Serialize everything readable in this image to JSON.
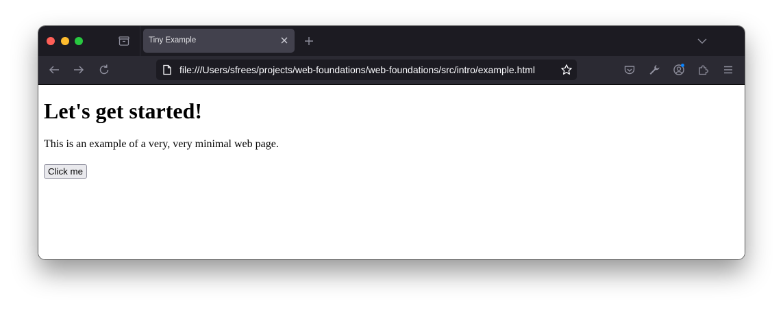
{
  "browser": {
    "window_controls": {
      "close_color": "#ff5f57",
      "minimize_color": "#febc2e",
      "maximize_color": "#28c840"
    },
    "tabs": [
      {
        "title": "Tiny Example",
        "active": true
      }
    ],
    "url": "file:///Users/sfrees/projects/web-foundations/web-foundations/src/intro/example.html",
    "toolbar_icons": [
      "back-arrow-icon",
      "forward-arrow-icon",
      "reload-icon",
      "page-icon",
      "bookmark-star-icon",
      "pocket-icon",
      "wrench-icon",
      "account-icon",
      "extensions-icon",
      "hamburger-menu-icon"
    ],
    "tab_icons": [
      "tab-manager-icon",
      "close-icon",
      "plus-icon",
      "chevron-down-icon"
    ],
    "colors": {
      "tabbar_bg": "#1c1b22",
      "toolbar_bg": "#2b2a33",
      "active_tab_bg": "#42414d",
      "account_badge": "#0a84ff"
    }
  },
  "page": {
    "heading": "Let's get started!",
    "paragraph": "This is an example of a very, very minimal web page.",
    "button_label": "Click me"
  }
}
